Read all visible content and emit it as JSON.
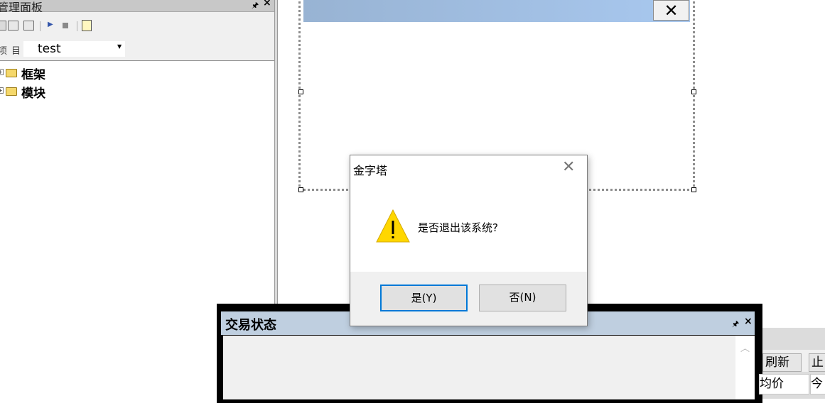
{
  "left_panel": {
    "title": "管理面板",
    "selector_label": "项目",
    "selector_value": "test",
    "tree": [
      {
        "label": "框架"
      },
      {
        "label": "模块"
      }
    ]
  },
  "trade_panel": {
    "title": "交易状态"
  },
  "right_panel": {
    "buttons": [
      "刷新",
      "止"
    ],
    "columns": [
      "均价",
      "今"
    ]
  },
  "message_box": {
    "title": "金字塔",
    "message": "是否退出该系统?",
    "yes_label": "是(Y)",
    "no_label": "否(N)",
    "icon": "warning-icon"
  },
  "colors": {
    "accent": "#0078d7",
    "warning": "#ffd700",
    "trade_titlebar": "#bfcfe0"
  }
}
